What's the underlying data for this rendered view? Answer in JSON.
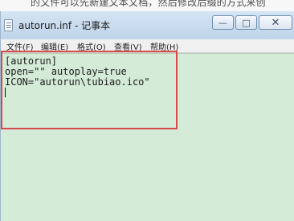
{
  "top_caption": {
    "text": "的文件可以先新建文本文档，然后修改后缀的方式来创"
  },
  "window": {
    "title": "autorun.inf - 记事本",
    "buttons": {
      "minimize": "—",
      "maximize": "□",
      "close": "✕"
    }
  },
  "menu": {
    "items": [
      {
        "label": "文件(F)"
      },
      {
        "label": "编辑(E)"
      },
      {
        "label": "格式(O)"
      },
      {
        "label": "查看(V)"
      },
      {
        "label": "帮助(H)"
      }
    ]
  },
  "editor": {
    "lines": [
      "[autorun]",
      "open=\"\" autoplay=true",
      "ICON=\"autorun\\tubiao.ico\""
    ]
  },
  "colors": {
    "editor_background": "#d3ebd7",
    "highlight_box": "#d84a4a"
  }
}
